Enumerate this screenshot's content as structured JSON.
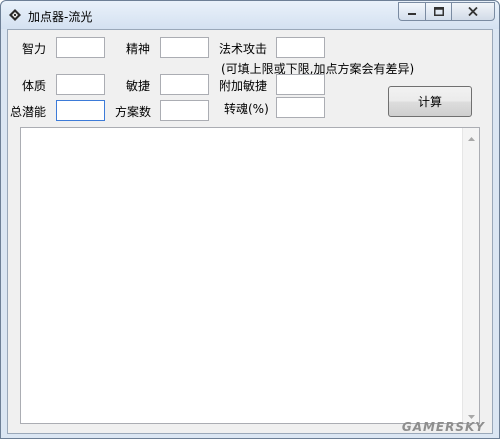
{
  "window": {
    "title": "加点器-流光",
    "icon": "app-icon"
  },
  "controls": {
    "minimize_icon": "minimize-icon",
    "maximize_icon": "maximize-icon",
    "close_icon": "close-icon"
  },
  "labels": {
    "zhili": "智力",
    "jingshen": "精神",
    "fashu_gongji": "法术攻击",
    "hint": "(可填上限或下限,加点方案会有差异)",
    "tizhi": "体质",
    "minjie": "敏捷",
    "fujia_minjie": "附加敏捷",
    "zong_qianneng": "总潜能",
    "fangan_shu": "方案数",
    "zhuanhun": "转魂(%)"
  },
  "fields": {
    "zhili": "",
    "jingshen": "",
    "fashu_gongji": "",
    "tizhi": "",
    "minjie": "",
    "fujia_minjie": "",
    "zong_qianneng": "",
    "fangan_shu": "",
    "zhuanhun": ""
  },
  "buttons": {
    "calculate": "计算"
  },
  "output": {
    "text": ""
  },
  "watermark": "GAMERSKY"
}
